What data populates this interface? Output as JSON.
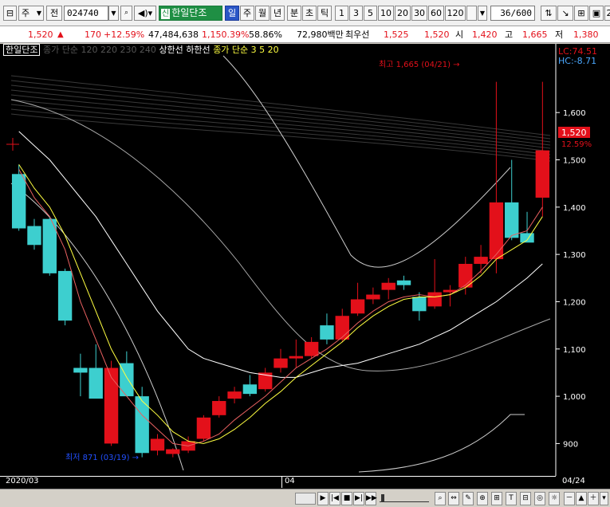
{
  "toolbar": {
    "period_type": "주",
    "prev_label": "전",
    "code": "024740",
    "name_tag": "신",
    "stock_name": "한일단조",
    "period_tabs": [
      "일",
      "주",
      "월",
      "년",
      "분",
      "초",
      "틱"
    ],
    "period_selected": "일",
    "minute_options": [
      "1",
      "3",
      "5",
      "10",
      "20",
      "30",
      "60",
      "120"
    ],
    "count": "36/600",
    "window_label": "2"
  },
  "quote": {
    "price": "1,520",
    "up_mark": "▲",
    "change": "170",
    "change_rate": "+12.59%",
    "volume": "47,484,638",
    "volume_rate": "1,150.39%",
    "turnover": "58.86%",
    "amount": "72,980백만",
    "best_ask_label": "최우선",
    "best_ask": "1,525",
    "best_bid": "1,520",
    "open_label": "시",
    "open": "1,420",
    "high_label": "고",
    "high": "1,665",
    "low_label": "저",
    "low": "1,380"
  },
  "legend": {
    "name": "한일단조",
    "ma_long": "종가 단순 120 220 230 240",
    "upper_limit": "상한선",
    "lower_limit": "하한선",
    "ma_short": "종가 단순 3 5 20"
  },
  "chart": {
    "high_label": "최고 1,665 (04/21) →",
    "low_label": "최저 871 (03/19) →",
    "lc_label": "LC:74.51",
    "hc_label": "HC:-8.71",
    "current_price": "1,520",
    "current_rate": "12.59%",
    "date_left": "2020/03",
    "date_mid": "04",
    "date_right": "04/24",
    "colors": {
      "up": "#e3101a",
      "down": "#3dcfcf",
      "ma3": "#e86060",
      "ma5": "#ffff40",
      "ma20": "#ffffff"
    }
  },
  "chart_data": {
    "type": "candlestick",
    "yticks": [
      900,
      1000,
      1100,
      1200,
      1300,
      1400,
      1500,
      1600
    ],
    "ylim": [
      840,
      1720
    ],
    "candles": [
      {
        "o": 1470,
        "h": 1490,
        "l": 1350,
        "c": 1355
      },
      {
        "o": 1360,
        "h": 1375,
        "l": 1310,
        "c": 1320
      },
      {
        "o": 1375,
        "h": 1380,
        "l": 1255,
        "c": 1260
      },
      {
        "o": 1265,
        "h": 1270,
        "l": 1150,
        "c": 1160
      },
      {
        "o": 1060,
        "h": 1090,
        "l": 1000,
        "c": 1050
      },
      {
        "o": 1060,
        "h": 1110,
        "l": 1000,
        "c": 995
      },
      {
        "o": 900,
        "h": 1075,
        "l": 895,
        "c": 1060
      },
      {
        "o": 1070,
        "h": 1095,
        "l": 1000,
        "c": 1000
      },
      {
        "o": 1000,
        "h": 1020,
        "l": 871,
        "c": 880
      },
      {
        "o": 885,
        "h": 920,
        "l": 875,
        "c": 910
      },
      {
        "o": 878,
        "h": 890,
        "l": 871,
        "c": 888
      },
      {
        "o": 885,
        "h": 915,
        "l": 880,
        "c": 905
      },
      {
        "o": 910,
        "h": 960,
        "l": 905,
        "c": 955
      },
      {
        "o": 960,
        "h": 1000,
        "l": 955,
        "c": 990
      },
      {
        "o": 995,
        "h": 1020,
        "l": 985,
        "c": 1010
      },
      {
        "o": 1025,
        "h": 1045,
        "l": 1000,
        "c": 1005
      },
      {
        "o": 1015,
        "h": 1060,
        "l": 1010,
        "c": 1050
      },
      {
        "o": 1060,
        "h": 1100,
        "l": 1050,
        "c": 1080
      },
      {
        "o": 1080,
        "h": 1120,
        "l": 1060,
        "c": 1085
      },
      {
        "o": 1085,
        "h": 1125,
        "l": 1080,
        "c": 1115
      },
      {
        "o": 1150,
        "h": 1175,
        "l": 1110,
        "c": 1120
      },
      {
        "o": 1120,
        "h": 1185,
        "l": 1115,
        "c": 1170
      },
      {
        "o": 1175,
        "h": 1240,
        "l": 1170,
        "c": 1205
      },
      {
        "o": 1205,
        "h": 1230,
        "l": 1195,
        "c": 1215
      },
      {
        "o": 1225,
        "h": 1250,
        "l": 1205,
        "c": 1240
      },
      {
        "o": 1245,
        "h": 1255,
        "l": 1225,
        "c": 1235
      },
      {
        "o": 1210,
        "h": 1220,
        "l": 1160,
        "c": 1180
      },
      {
        "o": 1190,
        "h": 1290,
        "l": 1185,
        "c": 1220
      },
      {
        "o": 1220,
        "h": 1235,
        "l": 1190,
        "c": 1225
      },
      {
        "o": 1230,
        "h": 1295,
        "l": 1215,
        "c": 1280
      },
      {
        "o": 1280,
        "h": 1320,
        "l": 1260,
        "c": 1295
      },
      {
        "o": 1290,
        "h": 1665,
        "l": 1260,
        "c": 1410
      },
      {
        "o": 1410,
        "h": 1500,
        "l": 1330,
        "c": 1335
      },
      {
        "o": 1345,
        "h": 1390,
        "l": 1330,
        "c": 1325
      },
      {
        "o": 1420,
        "h": 1665,
        "l": 1380,
        "c": 1520
      }
    ],
    "ma3": [
      1480,
      1420,
      1380,
      1310,
      1200,
      1120,
      1040,
      1000,
      960,
      930,
      900,
      895,
      905,
      920,
      950,
      975,
      1000,
      1030,
      1060,
      1080,
      1100,
      1125,
      1155,
      1180,
      1200,
      1210,
      1215,
      1210,
      1215,
      1235,
      1265,
      1300,
      1340,
      1350,
      1400
    ],
    "ma5": [
      1490,
      1440,
      1400,
      1340,
      1260,
      1180,
      1100,
      1040,
      990,
      960,
      925,
      905,
      900,
      910,
      930,
      955,
      985,
      1010,
      1040,
      1065,
      1090,
      1115,
      1145,
      1170,
      1190,
      1205,
      1210,
      1210,
      1215,
      1230,
      1255,
      1290,
      1310,
      1330,
      1380
    ],
    "ma20": [
      1560,
      1530,
      1500,
      1460,
      1420,
      1380,
      1330,
      1280,
      1230,
      1180,
      1140,
      1100,
      1080,
      1070,
      1060,
      1050,
      1045,
      1040,
      1040,
      1050,
      1060,
      1065,
      1070,
      1080,
      1090,
      1100,
      1110,
      1125,
      1140,
      1160,
      1180,
      1200,
      1225,
      1250,
      1280
    ]
  },
  "bottom": {
    "zoom_out": "－",
    "zoom_in": "＋",
    "up": "▲",
    "tail": "▾"
  }
}
